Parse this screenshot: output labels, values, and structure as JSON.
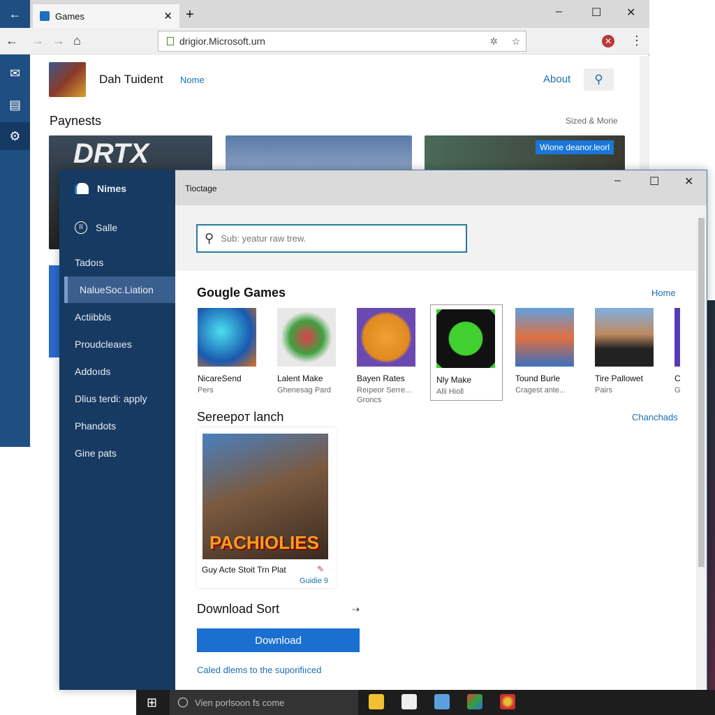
{
  "browser": {
    "tab_title": "Games",
    "address": "drigior.Microsoft.urn",
    "site_title": "Dah Tuident",
    "nav_home": "Nome",
    "about": "About",
    "section_title": "Paynests",
    "section_link": "Sized & Morie",
    "hero_text": "DRTX",
    "badge": "Wione deanor.leorl",
    "icons": [
      "back-icon",
      "forward-icon",
      "home-icon",
      "extension-icon",
      "star-icon",
      "close-red-icon",
      "more-icon",
      "mail-icon",
      "clipboard-icon",
      "settings-icon"
    ]
  },
  "app": {
    "sidebar": {
      "brand": "Nimes",
      "items": [
        "Salle",
        "Tadoıs",
        "NalueSoc.Liation",
        "Actiibbls",
        "Proudcleaıes",
        "Addoıds",
        "Dlius terdi: apply",
        "Phandots",
        "Gine pats"
      ],
      "selected_index": 2
    },
    "window_title": "Tioctage",
    "search_placeholder": "Sub: yeatur raw trew.",
    "games_section": {
      "title": "Gougle Games",
      "link": "Home",
      "cards": [
        {
          "title": "NicareSend",
          "sub": "Pers"
        },
        {
          "title": "Lalent Make",
          "sub": "Ghenesag Pard"
        },
        {
          "title": "Bayen Rates",
          "sub": "Reıpeor Serre... Groncs"
        },
        {
          "title": "Nly Make",
          "sub": "Alli Hioll"
        },
        {
          "title": "Tound Burle",
          "sub": "Cragest ante..."
        },
        {
          "title": "Tire Pallowet",
          "sub": "Pairs"
        },
        {
          "title": "C",
          "sub": "G"
        }
      ]
    },
    "launch_section": {
      "title": "Sereepoт lanch",
      "link": "Chanchads",
      "card_title": "Guy Acte Stoit Trn Plat",
      "card_art": "PACHIOLIES",
      "card_link": "Guidie 9"
    },
    "download_section": {
      "title": "Download Sort",
      "button": "Download",
      "link": "Caled dlems to the suporifiıced"
    }
  },
  "taskbar": {
    "search": "Vien porlsoon fs come"
  }
}
